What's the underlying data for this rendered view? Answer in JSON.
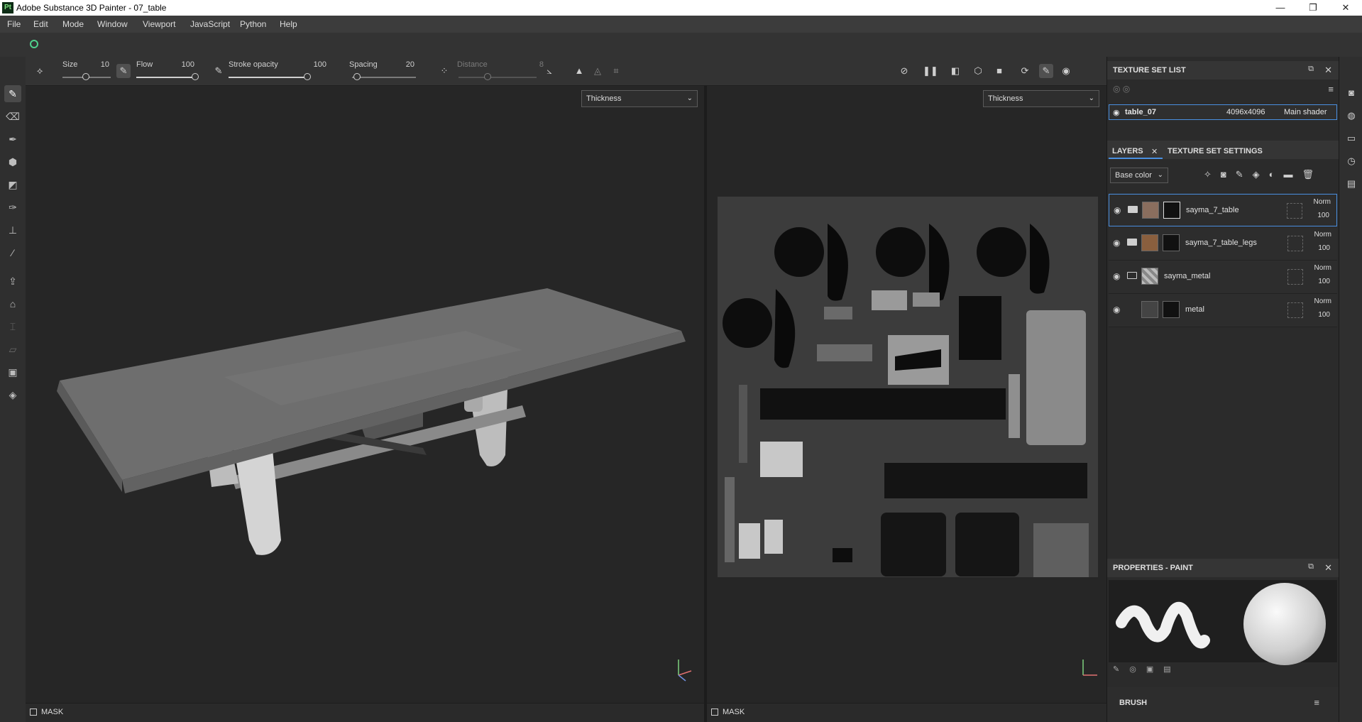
{
  "window": {
    "app_badge": "Pt",
    "title": "Adobe Substance 3D Painter - 07_table",
    "minimize": "—",
    "maximize": "❐",
    "close": "✕"
  },
  "menu": [
    "File",
    "Edit",
    "Mode",
    "Window",
    "Viewport",
    "JavaScript",
    "Python",
    "Help"
  ],
  "brush_toolbar": {
    "size_label": "Size",
    "size_value": "10",
    "flow_label": "Flow",
    "flow_value": "100",
    "stroke_opacity_label": "Stroke opacity",
    "stroke_opacity_value": "100",
    "spacing_label": "Spacing",
    "spacing_value": "20",
    "distance_label": "Distance",
    "distance_value": "8"
  },
  "viewport_3d": {
    "channel": "Thickness",
    "mask_label": "MASK"
  },
  "viewport_2d": {
    "channel": "Thickness",
    "mask_label": "MASK"
  },
  "texture_set_list": {
    "title": "TEXTURE SET LIST",
    "item": {
      "name": "table_07",
      "resolution": "4096x4096",
      "shader": "Main shader"
    }
  },
  "layers_panel": {
    "tab_layers": "LAYERS",
    "tab_close": "✕",
    "tab_texture_set_settings": "TEXTURE SET SETTINGS",
    "channel": "Base color",
    "layers": [
      {
        "name": "sayma_7_table",
        "blend": "Norm",
        "opacity": "100"
      },
      {
        "name": "sayma_7_table_legs",
        "blend": "Norm",
        "opacity": "100"
      },
      {
        "name": "sayma_metal",
        "blend": "Norm",
        "opacity": "100"
      },
      {
        "name": "metal",
        "blend": "Norm",
        "opacity": "100"
      }
    ]
  },
  "properties_panel": {
    "title": "PROPERTIES - PAINT",
    "brush_section": "BRUSH"
  },
  "colors": {
    "accent": "#4a8fe0",
    "logo": "#4fd08c"
  }
}
